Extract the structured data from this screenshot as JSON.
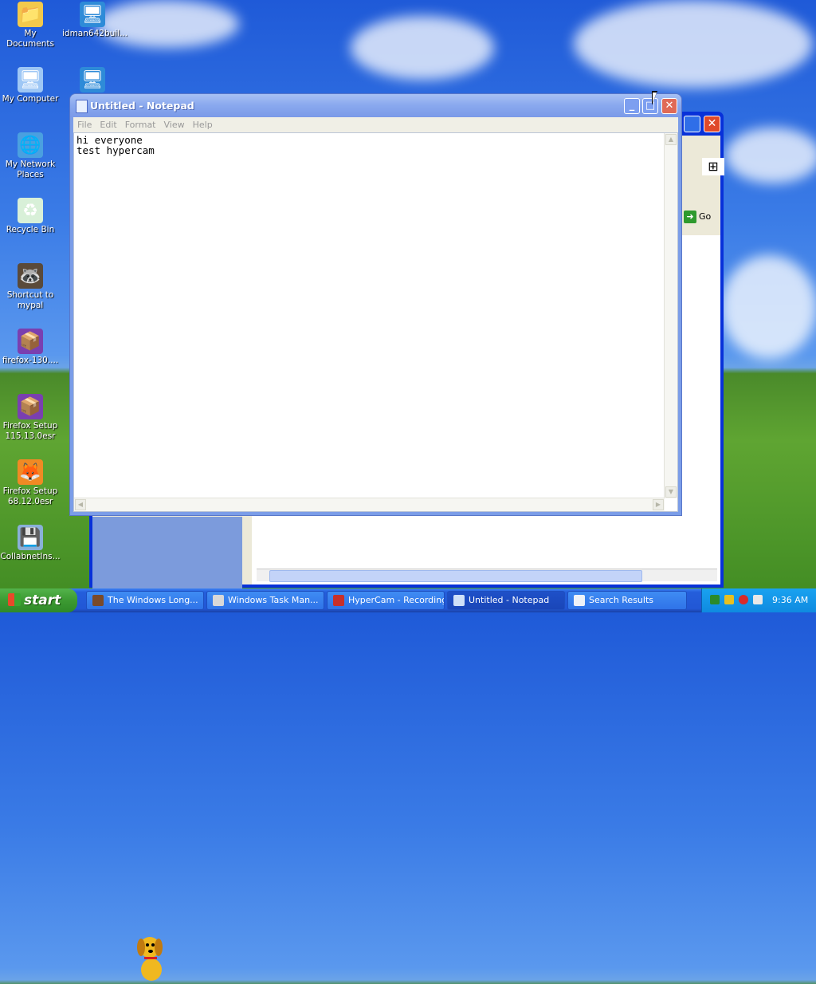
{
  "desktop": {
    "icons": [
      {
        "label": "My Documents",
        "icon": "folder-icon",
        "color": "#f2c94c"
      },
      {
        "label": "idman642buil...",
        "icon": "installer-icon",
        "color": "#2e8bd8"
      },
      {
        "label": "My Computer",
        "icon": "computer-icon",
        "color": "#9ec7f5"
      },
      {
        "label": "My Network Places",
        "icon": "network-icon",
        "color": "#4aa0e0"
      },
      {
        "label": "Recycle Bin",
        "icon": "recycle-bin-icon",
        "color": "#d8f0d8"
      },
      {
        "label": "Shortcut to mypal",
        "icon": "mypal-icon",
        "color": "#5a4a3a"
      },
      {
        "label": "firefox-130....",
        "icon": "firefox-package-icon",
        "color": "#7a3fb0"
      },
      {
        "label": "Firefox Setup 115.13.0esr",
        "icon": "firefox-package-icon",
        "color": "#7a3fb0"
      },
      {
        "label": "Firefox Setup 68.12.0esr",
        "icon": "firefox-icon",
        "color": "#f08a24"
      },
      {
        "label": "CollabnetIns...",
        "icon": "installer-icon",
        "color": "#8ab0d8"
      }
    ]
  },
  "notepad": {
    "title": "Untitled - Notepad",
    "menu": [
      "File",
      "Edit",
      "Format",
      "View",
      "Help"
    ],
    "content": "hi everyone\ntest hypercam",
    "min_glyph": "_",
    "max_glyph": "□",
    "close_glyph": "✕"
  },
  "background_window": {
    "go_label": "Go",
    "close_glyph": "✕"
  },
  "taskbar": {
    "start_label": "start",
    "buttons": [
      {
        "label": "The Windows Long...",
        "icon": "ie-icon"
      },
      {
        "label": "Windows Task Man...",
        "icon": "task-manager-icon"
      },
      {
        "label": "HyperCam - Recording",
        "icon": "hypercam-icon"
      },
      {
        "label": "Untitled - Notepad",
        "icon": "notepad-icon",
        "active": true
      },
      {
        "label": "Search Results",
        "icon": "search-results-icon"
      }
    ],
    "clock": "9:36 AM"
  }
}
